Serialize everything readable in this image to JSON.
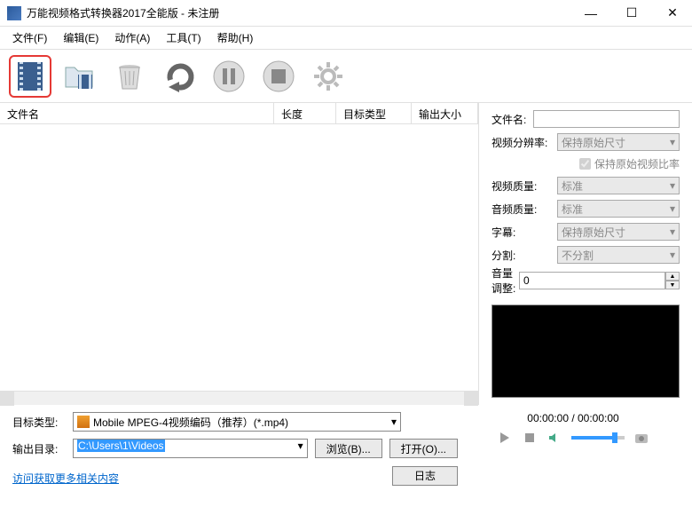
{
  "window": {
    "title": "万能视频格式转换器2017全能版 - 未注册"
  },
  "menu": {
    "file": "文件(F)",
    "edit": "编辑(E)",
    "action": "动作(A)",
    "tools": "工具(T)",
    "help": "帮助(H)"
  },
  "toolbar_icons": {
    "add_file": "add-file-icon",
    "folder": "folder-icon",
    "delete": "delete-icon",
    "convert": "convert-icon",
    "pause": "pause-icon",
    "stop": "stop-icon",
    "settings": "settings-icon"
  },
  "list": {
    "col_name": "文件名",
    "col_length": "长度",
    "col_target_type": "目标类型",
    "col_output_size": "输出大小"
  },
  "props": {
    "filename_label": "文件名:",
    "filename_value": "",
    "resolution_label": "视频分辨率:",
    "resolution_value": "保持原始尺寸",
    "keep_ratio_label": "保持原始视频比率",
    "video_quality_label": "视频质量:",
    "video_quality_value": "标准",
    "audio_quality_label": "音频质量:",
    "audio_quality_value": "标准",
    "subtitle_label": "字幕:",
    "subtitle_value": "保持原始尺寸",
    "split_label": "分割:",
    "split_value": "不分割",
    "volume_label": "音量调整:",
    "volume_value": "0"
  },
  "bottom": {
    "target_type_label": "目标类型:",
    "target_type_value": "Mobile MPEG-4视频编码（推荐）(*.mp4)",
    "output_dir_label": "输出目录:",
    "output_dir_value": "C:\\Users\\1\\Videos",
    "browse_btn": "浏览(B)...",
    "open_btn": "打开(O)...",
    "log_btn": "日志",
    "more_link": "访问获取更多相关内容"
  },
  "player": {
    "time": "00:00:00 / 00:00:00"
  }
}
